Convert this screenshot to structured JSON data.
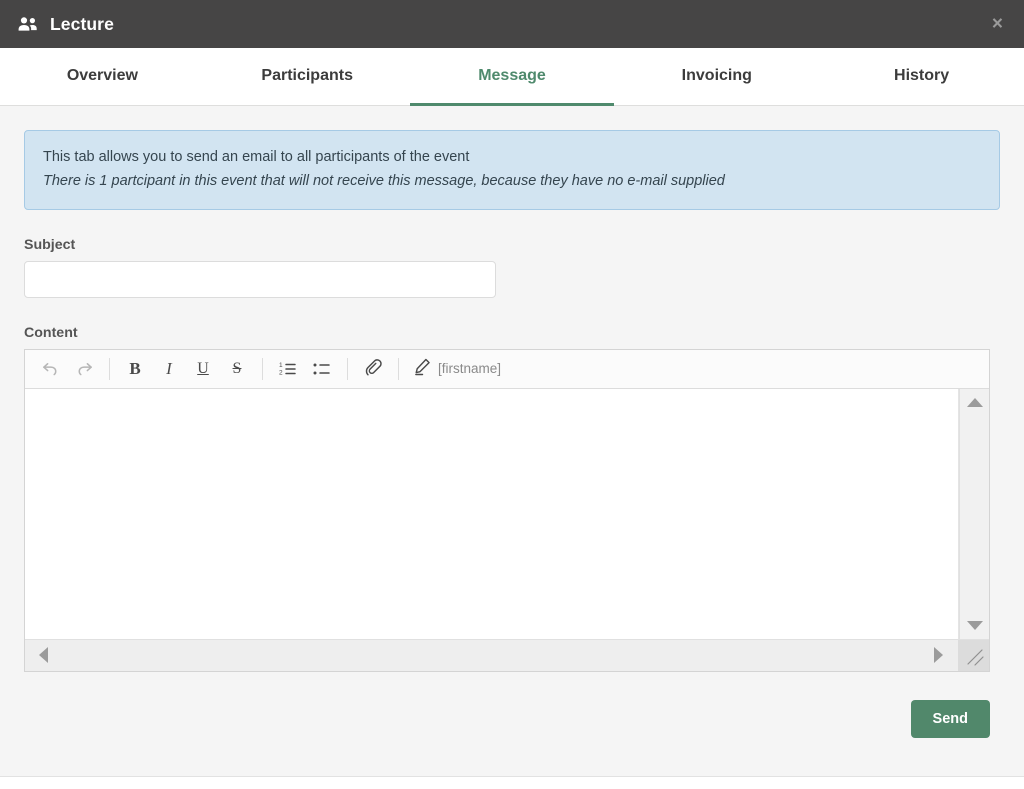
{
  "header": {
    "icon": "users-icon",
    "title": "Lecture",
    "close_label": "×",
    "background_color": "#464545"
  },
  "tabs": [
    {
      "label": "Overview",
      "active": false
    },
    {
      "label": "Participants",
      "active": false
    },
    {
      "label": "Message",
      "active": true
    },
    {
      "label": "Invoicing",
      "active": false
    },
    {
      "label": "History",
      "active": false
    }
  ],
  "accent_color": "#4f8a6d",
  "alert": {
    "line1": "This tab allows you to send an email to all participants of the event",
    "line2": "There is 1 partcipant in this event that will not receive this message, because they have no e-mail supplied",
    "background_color": "#d2e4f1",
    "border_color": "#a6cae5"
  },
  "form": {
    "subject_label": "Subject",
    "subject_value": "",
    "subject_placeholder": "",
    "content_label": "Content",
    "content_value": "",
    "content_placeholder": ""
  },
  "editor_toolbar": {
    "buttons": [
      {
        "name": "undo-icon",
        "label": ""
      },
      {
        "name": "redo-icon",
        "label": ""
      },
      {
        "name": "bold-icon",
        "label": "B"
      },
      {
        "name": "italic-icon",
        "label": "I"
      },
      {
        "name": "underline-icon",
        "label": "U"
      },
      {
        "name": "strikethrough-icon",
        "label": "S"
      },
      {
        "name": "ordered-list-icon",
        "label": ""
      },
      {
        "name": "bullet-list-icon",
        "label": ""
      },
      {
        "name": "link-icon",
        "label": ""
      }
    ],
    "merge_token": {
      "icon": "pencil-icon",
      "label": "[firstname]"
    }
  },
  "actions": {
    "send_label": "Send",
    "send_color": "#51886b"
  }
}
